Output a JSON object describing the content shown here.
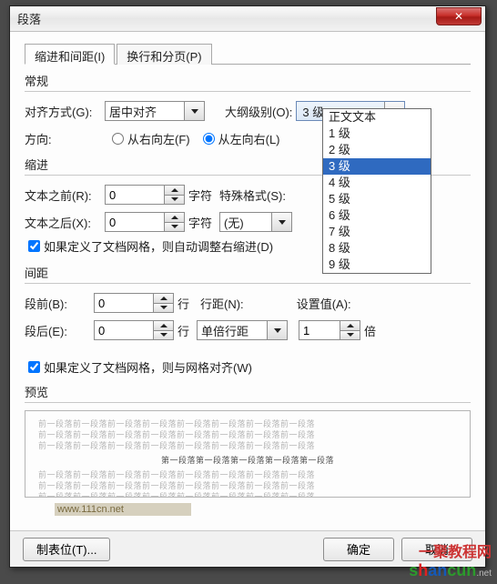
{
  "window": {
    "title": "段落"
  },
  "tabs": {
    "active": "缩进和间距(I)",
    "inactive": "换行和分页(P)"
  },
  "groups": {
    "general": "常规",
    "indent": "缩进",
    "spacing": "间距",
    "preview": "预览"
  },
  "general": {
    "align_label": "对齐方式(G):",
    "align_value": "居中对齐",
    "outline_label": "大纲级别(O):",
    "outline_value": "3 级",
    "dir_label": "方向:",
    "rtl": "从右向左(F)",
    "ltr": "从左向右(L)"
  },
  "outline_options": [
    "正文文本",
    "1 级",
    "2 级",
    "3 级",
    "4 级",
    "5 级",
    "6 级",
    "7 级",
    "8 级",
    "9 级"
  ],
  "indent": {
    "before_label": "文本之前(R):",
    "before_value": "0",
    "after_label": "文本之后(X):",
    "after_value": "0",
    "unit": "字符",
    "special_label": "特殊格式(S):",
    "special_value": "(无)",
    "grid_check": "如果定义了文档网格，则自动调整右缩进(D)"
  },
  "spacing": {
    "before_label": "段前(B):",
    "before_value": "0",
    "after_label": "段后(E):",
    "after_value": "0",
    "row_unit": "行",
    "line_label": "行距(N):",
    "line_value": "单倍行距",
    "setval_label": "设置值(A):",
    "setval_value": "1",
    "setval_unit": "倍",
    "grid_check": "如果定义了文档网格，则与网格对齐(W)"
  },
  "buttons": {
    "tabstops": "制表位(T)...",
    "ok": "确定",
    "cancel": "取消"
  },
  "preview_text": "前一段落前一段落前一段落前一段落前一段落前一段落前一段落前一段落",
  "preview_sample": "第一段落第一段落第一段落第一段落第一段落",
  "watermark": {
    "right_top": "www.111cn.net",
    "brand_text": "一聚教程网",
    "domain": "shancun.net"
  }
}
